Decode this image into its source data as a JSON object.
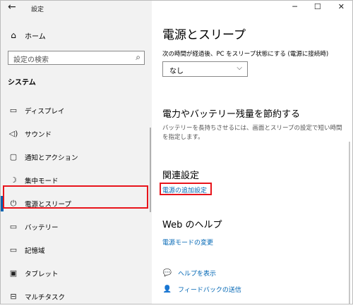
{
  "titlebar": {
    "back_icon": "←",
    "title": "設定",
    "minimize": "─",
    "maximize": "☐",
    "close": "✕"
  },
  "sidebar": {
    "home": {
      "icon": "⌂",
      "label": "ホーム"
    },
    "search_placeholder": "設定の検索",
    "search_icon": "⌕",
    "section_title": "システム",
    "items": [
      {
        "icon": "▭",
        "label": "ディスプレイ",
        "active": false
      },
      {
        "icon": "◁)",
        "label": "サウンド",
        "active": false
      },
      {
        "icon": "▢",
        "label": "通知とアクション",
        "active": false
      },
      {
        "icon": "☽",
        "label": "集中モード",
        "active": false
      },
      {
        "icon": "⏻",
        "label": "電源とスリープ",
        "active": true
      },
      {
        "icon": "▭",
        "label": "バッテリー",
        "active": false
      },
      {
        "icon": "▭",
        "label": "記憶域",
        "active": false
      },
      {
        "icon": "▣",
        "label": "タブレット",
        "active": false
      },
      {
        "icon": "⊟",
        "label": "マルチタスク",
        "active": false
      }
    ]
  },
  "main": {
    "title": "電源とスリープ",
    "sleep_label": "次の時間が経過後、PC をスリープ状態にする (電源に接続時)",
    "sleep_value": "なし",
    "save_heading": "電力やバッテリー残量を節約する",
    "save_desc": "バッテリーを長持ちさせるには、画面とスリープの設定で短い時間を指定します。",
    "related_heading": "関連設定",
    "power_link": "電源の追加設定",
    "web_help_heading": "Web のヘルプ",
    "power_mode_link": "電源モードの変更",
    "help_link": "ヘルプを表示",
    "feedback_link": "フィードバックの送信",
    "help_icon": "💬",
    "feedback_icon": "👤"
  },
  "colors": {
    "accent": "#0063b1",
    "link": "#0066b4",
    "highlight": "#e8141b"
  }
}
